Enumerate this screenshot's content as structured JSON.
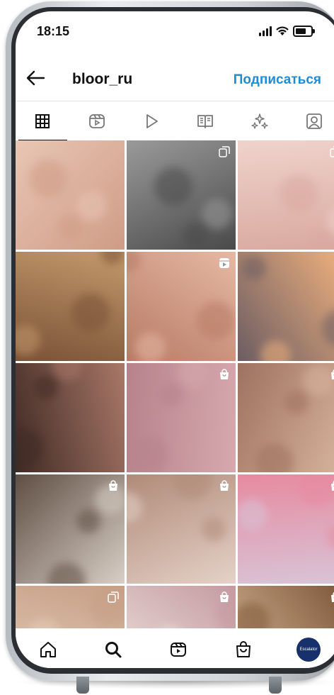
{
  "status_bar": {
    "time": "18:15"
  },
  "header": {
    "username": "bloor_ru",
    "follow_label": "Подписаться"
  },
  "tabs": [
    {
      "icon": "grid-icon",
      "active": true
    },
    {
      "icon": "reels-icon",
      "active": false
    },
    {
      "icon": "play-icon",
      "active": false
    },
    {
      "icon": "guide-book-icon",
      "active": false
    },
    {
      "icon": "sparkles-icon",
      "active": false
    },
    {
      "icon": "tagged-person-icon",
      "active": false
    }
  ],
  "grid_posts": [
    {
      "name": "post-two-faces-closeup",
      "badge": "",
      "colors": [
        "#e8c6b4",
        "#cf9c86"
      ]
    },
    {
      "name": "post-vintage-fur-coat-bw",
      "badge": "multi-photo-icon",
      "colors": [
        "#9a9a9a",
        "#4a4a4a"
      ]
    },
    {
      "name": "post-pink-gua-sha-stones",
      "badge": "multi-photo-icon",
      "colors": [
        "#efd3cb",
        "#d9a9a0"
      ]
    },
    {
      "name": "post-window-bath",
      "badge": "",
      "colors": [
        "#c49a6c",
        "#7a5136"
      ]
    },
    {
      "name": "post-rose-gold-roller",
      "badge": "reels-icon",
      "colors": [
        "#e6b9a4",
        "#b77a64"
      ]
    },
    {
      "name": "post-city-sunset-window",
      "badge": "",
      "colors": [
        "#f1b27e",
        "#6b5c62"
      ]
    },
    {
      "name": "post-retro-woman-lipstick",
      "badge": "",
      "colors": [
        "#a97868",
        "#3f2a24"
      ]
    },
    {
      "name": "post-tulips-heart-stones",
      "badge": "shopping-bag-icon",
      "colors": [
        "#d6a9ae",
        "#b7828b"
      ]
    },
    {
      "name": "post-gold-chain-roller",
      "badge": "shopping-bag-icon",
      "colors": [
        "#d9b59e",
        "#9e7260"
      ]
    },
    {
      "name": "post-woman-bed-reading",
      "badge": "shopping-bag-icon",
      "colors": [
        "#d8cfc6",
        "#5f4e43"
      ]
    },
    {
      "name": "post-towel-eye-patches",
      "badge": "shopping-bag-icon",
      "colors": [
        "#e5d2c8",
        "#b08a78"
      ]
    },
    {
      "name": "post-pink-cake-roller",
      "badge": "shopping-bag-icon",
      "colors": [
        "#d8c4d6",
        "#e78aa0"
      ]
    },
    {
      "name": "post-back-sand-dress",
      "badge": "multi-photo-icon",
      "colors": [
        "#e4cdbb",
        "#c79f86"
      ]
    },
    {
      "name": "post-white-tulips",
      "badge": "shopping-bag-icon",
      "colors": [
        "#eee7e0",
        "#c59aa0"
      ]
    },
    {
      "name": "post-bulldog",
      "badge": "shopping-bag-icon",
      "colors": [
        "#d9b99a",
        "#7d5638"
      ]
    }
  ],
  "bottom_nav": [
    {
      "icon": "home-icon"
    },
    {
      "icon": "search-icon"
    },
    {
      "icon": "reels-icon"
    },
    {
      "icon": "shopping-bag-icon"
    },
    {
      "icon": "profile-avatar",
      "text": "Escalator"
    }
  ],
  "colors": {
    "accent": "#1f8cd6",
    "avatar_bg": "#18306b"
  }
}
